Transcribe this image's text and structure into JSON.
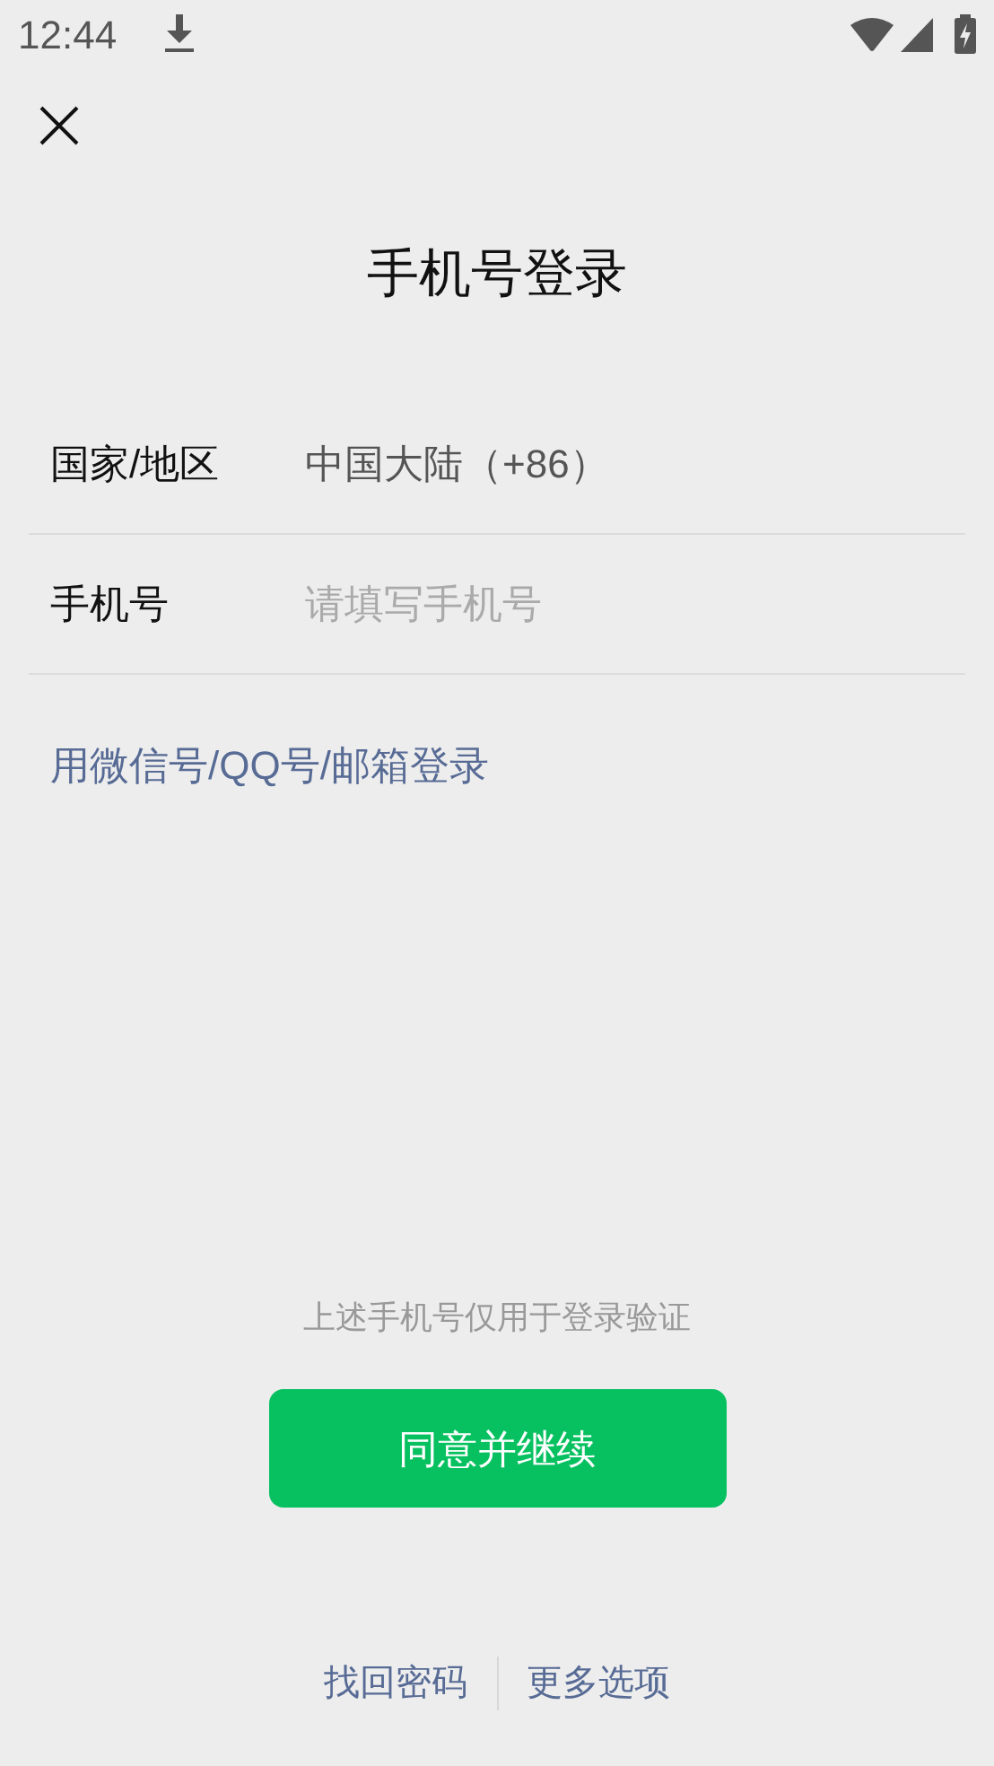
{
  "status_bar": {
    "time": "12:44"
  },
  "title": "手机号登录",
  "fields": [
    {
      "label": "国家/地区",
      "kind": "value",
      "text": "中国大陆（+86）"
    },
    {
      "label": "手机号",
      "kind": "input",
      "placeholder": "请填写手机号"
    }
  ],
  "alt_login_link": "用微信号/QQ号/邮箱登录",
  "notice": "上述手机号仅用于登录验证",
  "primary_button": "同意并继续",
  "footer_links": [
    "找回密码",
    "更多选项"
  ]
}
